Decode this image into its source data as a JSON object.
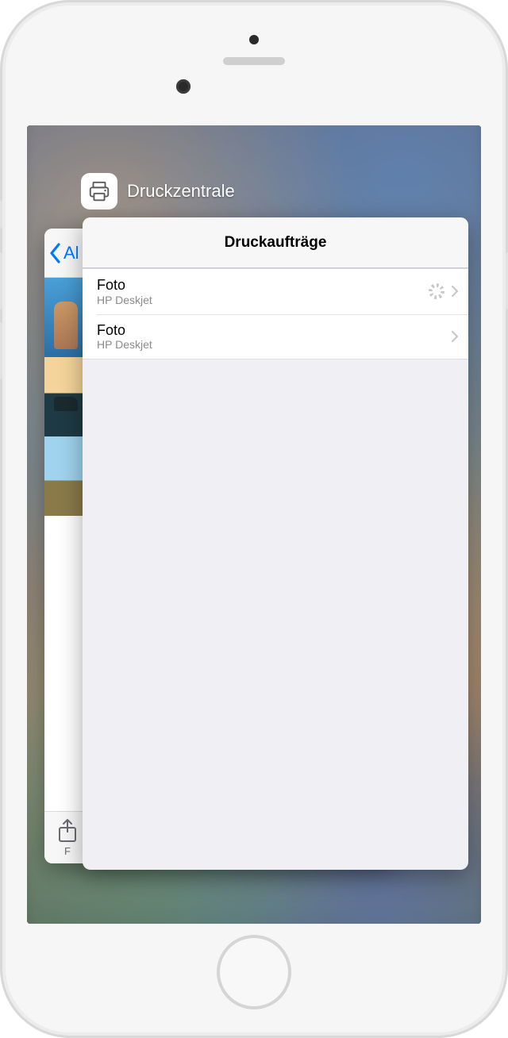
{
  "switcher": {
    "app_name": "Druckzentrale",
    "icon": "printer-icon"
  },
  "back_app": {
    "back_label": "Al",
    "footer_label": "F"
  },
  "print_center": {
    "header_title": "Druckaufträge",
    "jobs": [
      {
        "title": "Foto",
        "printer": "HP Deskjet",
        "status": "loading"
      },
      {
        "title": "Foto",
        "printer": "HP Deskjet",
        "status": "idle"
      }
    ]
  }
}
